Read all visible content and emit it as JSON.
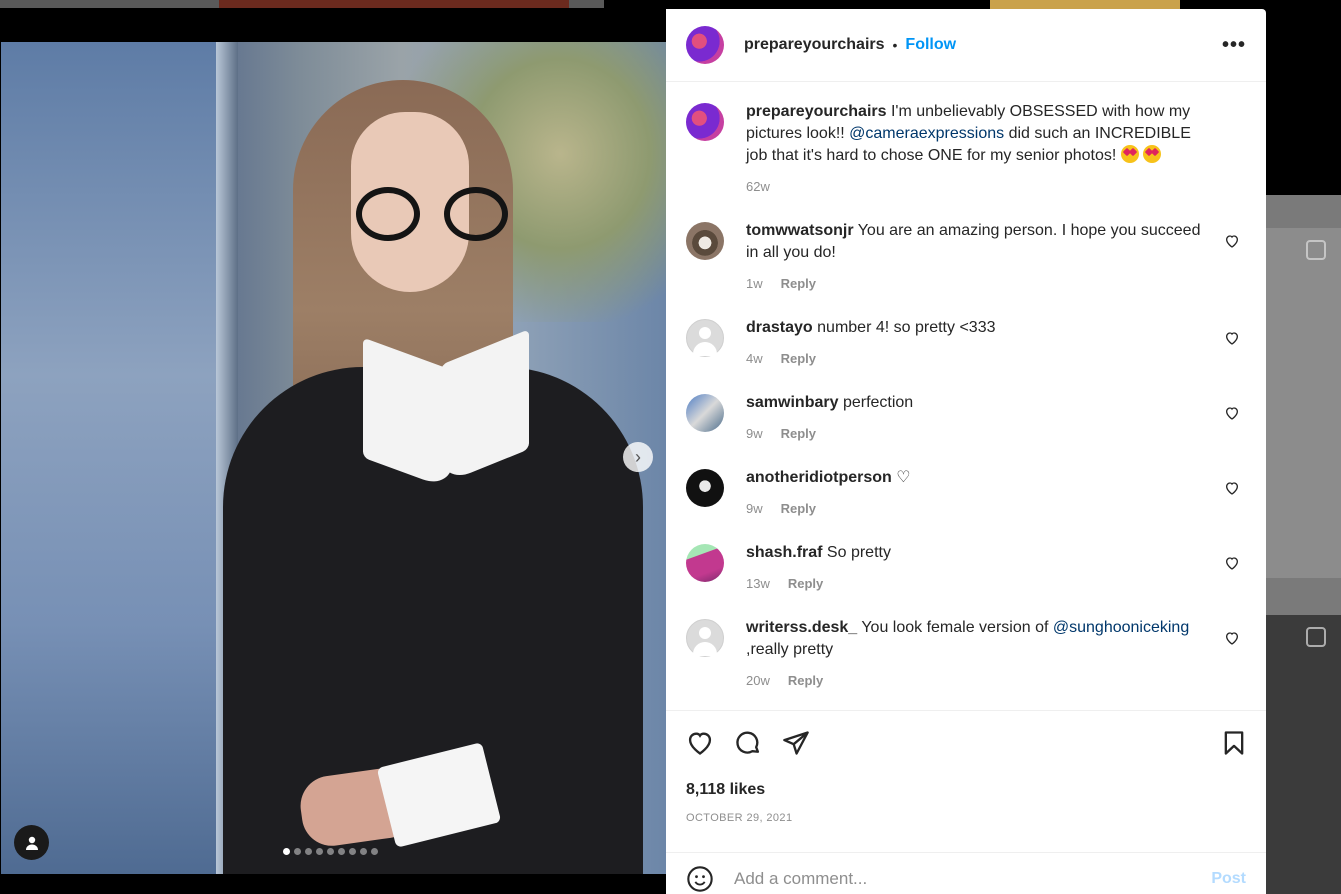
{
  "post": {
    "username": "prepareyourchairs",
    "separator": "•",
    "follow_label": "Follow",
    "more_label": "•••",
    "likes": "8,118 likes",
    "date": "OCTOBER 29, 2021",
    "carousel": {
      "slide_count": 9,
      "active_index": 0
    }
  },
  "caption": {
    "username": "prepareyourchairs",
    "text_1": "I'm unbelievably OBSESSED with how my pictures look!! ",
    "mention": "@cameraexpressions",
    "text_2": " did such an INCREDIBLE job that it's hard to chose ONE for my senior photos! ",
    "time": "62w"
  },
  "comments": [
    {
      "username": "tomwwatsonjr",
      "text": "You are an amazing person. I hope you succeed in all you do!",
      "time": "1w",
      "reply": "Reply",
      "avatar": "tom"
    },
    {
      "username": "drastayo",
      "text": "number 4! so pretty <333",
      "time": "4w",
      "reply": "Reply",
      "avatar": "blank"
    },
    {
      "username": "samwinbary",
      "text": "perfection",
      "time": "9w",
      "reply": "Reply",
      "avatar": "sam"
    },
    {
      "username": "anotheridiotperson",
      "text": "♡",
      "time": "9w",
      "reply": "Reply",
      "avatar": "another"
    },
    {
      "username": "shash.fraf",
      "text": "So pretty",
      "time": "13w",
      "reply": "Reply",
      "avatar": "shash"
    },
    {
      "username": "writerss.desk_",
      "text_1": "You look female version of ",
      "mention": "@sunghooniceking",
      "text_2": " ,really pretty",
      "time": "20w",
      "reply": "Reply",
      "avatar": "blank"
    }
  ],
  "composer": {
    "placeholder": "Add a comment...",
    "post_label": "Post"
  },
  "icons": [
    "heart-icon",
    "comment-icon",
    "share-icon",
    "bookmark-icon",
    "emoji-icon",
    "chevron-right-icon",
    "user-tag-icon"
  ],
  "colors": {
    "link": "#0095f6",
    "mention": "#00376b",
    "muted": "#8e8e8e",
    "post_disabled": "#b3dbff"
  }
}
